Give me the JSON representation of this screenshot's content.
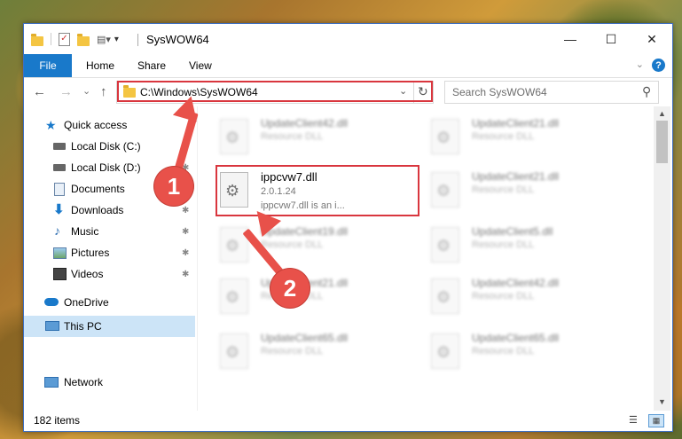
{
  "window": {
    "title": "SysWOW64",
    "controls": {
      "minimize": "—",
      "maximize": "☐",
      "close": "✕"
    }
  },
  "ribbon": {
    "tabs": [
      "File",
      "Home",
      "Share",
      "View"
    ],
    "help": "?",
    "expand": "⌄"
  },
  "navigation": {
    "back": "←",
    "forward": "→",
    "recent": "⌄",
    "up": "↑",
    "address": "C:\\Windows\\SysWOW64",
    "dropdown": "⌄",
    "refresh": "↻",
    "search_placeholder": "Search SysWOW64",
    "search_icon": "⚲"
  },
  "sidebar": {
    "items": [
      {
        "label": "Quick access",
        "icon": "star-icon",
        "pinned": false
      },
      {
        "label": "Local Disk (C:)",
        "icon": "drive-icon",
        "pinned": true
      },
      {
        "label": "Local Disk (D:)",
        "icon": "drive-icon",
        "pinned": true
      },
      {
        "label": "Documents",
        "icon": "documents-icon",
        "pinned": true
      },
      {
        "label": "Downloads",
        "icon": "download-icon",
        "pinned": true
      },
      {
        "label": "Music",
        "icon": "music-icon",
        "pinned": true
      },
      {
        "label": "Pictures",
        "icon": "pictures-icon",
        "pinned": true
      },
      {
        "label": "Videos",
        "icon": "videos-icon",
        "pinned": true
      },
      {
        "label": "OneDrive",
        "icon": "cloud-icon",
        "pinned": false
      },
      {
        "label": "This PC",
        "icon": "computer-icon",
        "pinned": false,
        "selected": true
      },
      {
        "label": "Network",
        "icon": "network-icon",
        "pinned": false
      }
    ],
    "pin_glyph": "📌"
  },
  "files": {
    "highlighted": {
      "name": "ippcvw7.dll",
      "version": "2.0.1.24",
      "description": "ippcvw7.dll is an i..."
    },
    "blurred": [
      {
        "name": "UpdateClient42.dll",
        "type": "Resource DLL"
      },
      {
        "name": "UpdateClient21.dll",
        "type": "Resource DLL"
      },
      {
        "name": "UpdateClient21.dll",
        "type": "Resource DLL"
      },
      {
        "name": "UpdateClient19.dll",
        "type": "Resource DLL"
      },
      {
        "name": "UpdateClient5.dll",
        "type": "Resource DLL"
      },
      {
        "name": "UpdateClient21.dll",
        "type": "Resource DLL"
      },
      {
        "name": "UpdateClient42.dll",
        "type": "Resource DLL"
      },
      {
        "name": "UpdateClient65.dll",
        "type": "Resource DLL"
      },
      {
        "name": "UpdateClient65.dll",
        "type": "Resource DLL"
      }
    ]
  },
  "status": {
    "item_count": "182 items"
  },
  "annotations": {
    "step1": "1",
    "step2": "2"
  },
  "colors": {
    "accent": "#1979ca",
    "annotation": "#e8514a",
    "highlight_border": "#d9363e",
    "selection": "#cce4f7"
  }
}
